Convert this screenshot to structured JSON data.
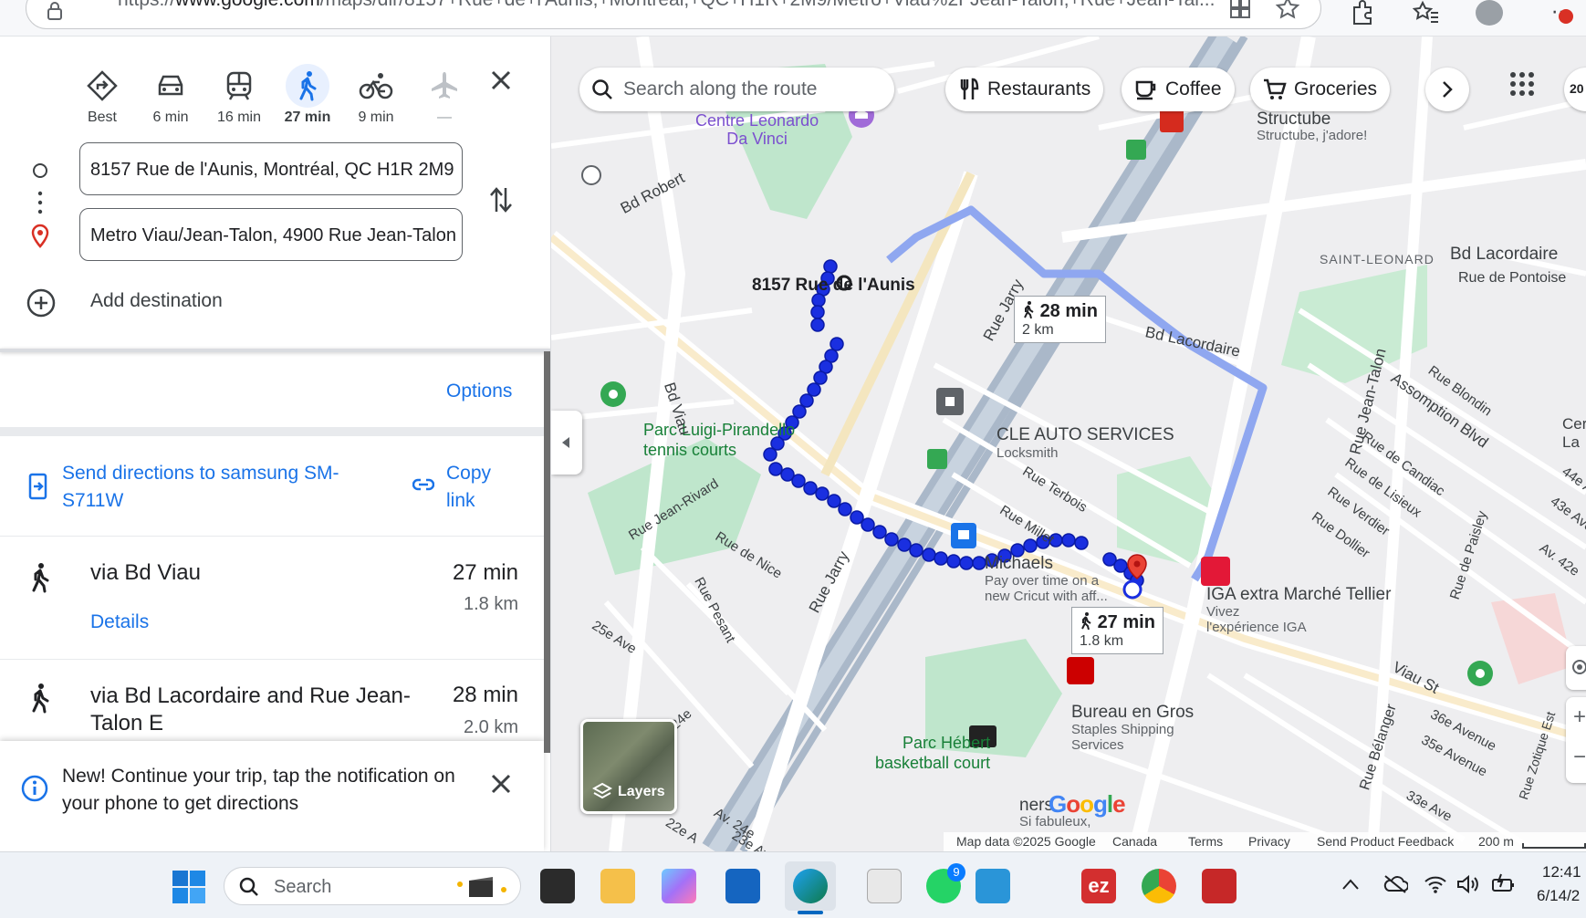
{
  "browser": {
    "url_prefix": "https://",
    "url_domain": "www.google.com",
    "url_rest": "/maps/dir/8157+Rue+de+l'Aunis,+Montréal,+QC+H1R+2M9/Metro+Viau%2FJean-Talon,+Rue+Jean-Tal..."
  },
  "modes": [
    {
      "name": "Best",
      "label": "Best"
    },
    {
      "name": "driving",
      "label": "6 min"
    },
    {
      "name": "transit",
      "label": "16 min"
    },
    {
      "name": "walking",
      "label": "27 min",
      "selected": true
    },
    {
      "name": "cycling",
      "label": "9 min"
    },
    {
      "name": "flights",
      "label": "—"
    }
  ],
  "directions": {
    "origin": "8157 Rue de l'Aunis, Montréal, QC H1R 2M9",
    "destination": "Metro Viau/Jean-Talon, 4900 Rue Jean-Talon",
    "add_destination": "Add destination",
    "options": "Options",
    "send_directions": "Send directions to samsung SM-S711W",
    "copy_link": "Copy link"
  },
  "routes": [
    {
      "title": "via Bd Viau",
      "time": "27 min",
      "distance": "1.8 km",
      "details": "Details"
    },
    {
      "title": "via Bd Lacordaire and Rue Jean-Talon E",
      "time": "28 min",
      "distance": "2.0 km"
    }
  ],
  "notice": {
    "text": "New! Continue your trip, tap the notification on your phone to get directions"
  },
  "map": {
    "search_placeholder": "Search along the route",
    "chips": [
      "Restaurants",
      "Coffee",
      "Groceries"
    ],
    "zoom_partial": "20",
    "labels": {
      "origin": "8157 Rue de l'Aunis",
      "leonardo": "Centre Leonardo",
      "leonardo2": "Da Vinci",
      "structube": "Structube",
      "structube_sub": "Structube, j'adore!",
      "saint_leonard": "SAINT-LEONARD",
      "lacordaire_ne": "Bd Lacordaire",
      "pontoise": "Rue de Pontoise",
      "parc_luigi": "Parc Luigi-Pirandello",
      "parc_luigi2": "tennis courts",
      "cle_auto": "CLE AUTO SERVICES",
      "cle_auto_sub": "Locksmith",
      "michaels": "Michaels",
      "michaels_sub1": "Pay over time on a",
      "michaels_sub2": "new Cricut with aff...",
      "iga": "IGA extra Marché Tellier",
      "iga_sub1": "Vivez",
      "iga_sub2": "l'expérience IGA",
      "bureau": "Bureau en Gros",
      "bureau_sub1": "Staples Shipping",
      "bureau_sub2": "Services",
      "parc_hebert": "Parc Hébert",
      "parc_hebert2": "basketball court",
      "winners": "ners",
      "winners_sub": "Si fabuleux,",
      "bd_robert": "Bd Robert",
      "bd_viau": "Bd Viau",
      "rue_jarry": "Rue Jarry",
      "rue_jarry2": "Rue Jarry",
      "bd_lacordaire": "Bd Lacordaire",
      "rue_jean_talon": "Rue Jean-Talon",
      "assomption": "Assomption Blvd",
      "rue_blondin": "Rue Blondin",
      "rue_candiac": "Rue de Candiac",
      "rue_lisieux": "Rue de Lisieux",
      "rue_verdier": "Rue Verdier",
      "rue_dollier": "Rue Dollier",
      "rue_terbois": "Rue Terbois",
      "rue_millet": "Rue Millet",
      "rue_nice": "Rue de Nice",
      "rue_pesant": "Rue Pesant",
      "rue_jean_rivard": "Rue Jean-Rivard",
      "viau_st": "Viau St",
      "rue_belanger": "Rue Bélanger",
      "rue_paisley": "Rue de Paisley",
      "av_42e": "Av. 42e",
      "av_43e": "43e Avenu",
      "av_44e": "44e Av",
      "av_36e": "36e Avenue",
      "av_35e": "35e Avenue",
      "av_33e": "33e Ave",
      "av_25e": "25e Ave",
      "av_24e": "24e",
      "av_24e2": "Av. 24e",
      "av_22e": "22e A",
      "av_23e": "23e Av",
      "zotique": "Rue Zotique Est",
      "cem": "Cer",
      "cem2": "La"
    },
    "time_box_1": {
      "time": "28 min",
      "distance": "2 km"
    },
    "time_box_2": {
      "time": "27 min",
      "distance": "1.8 km"
    },
    "layers": "Layers",
    "footer": {
      "map_data": "Map data ©2025 Google",
      "canada": "Canada",
      "terms": "Terms",
      "privacy": "Privacy",
      "feedback": "Send Product Feedback",
      "scale": "200 m"
    },
    "google_logo": "Google"
  },
  "taskbar": {
    "search": "Search",
    "whatsapp_badge": "9",
    "time": "12:41",
    "date": "6/14/2"
  }
}
